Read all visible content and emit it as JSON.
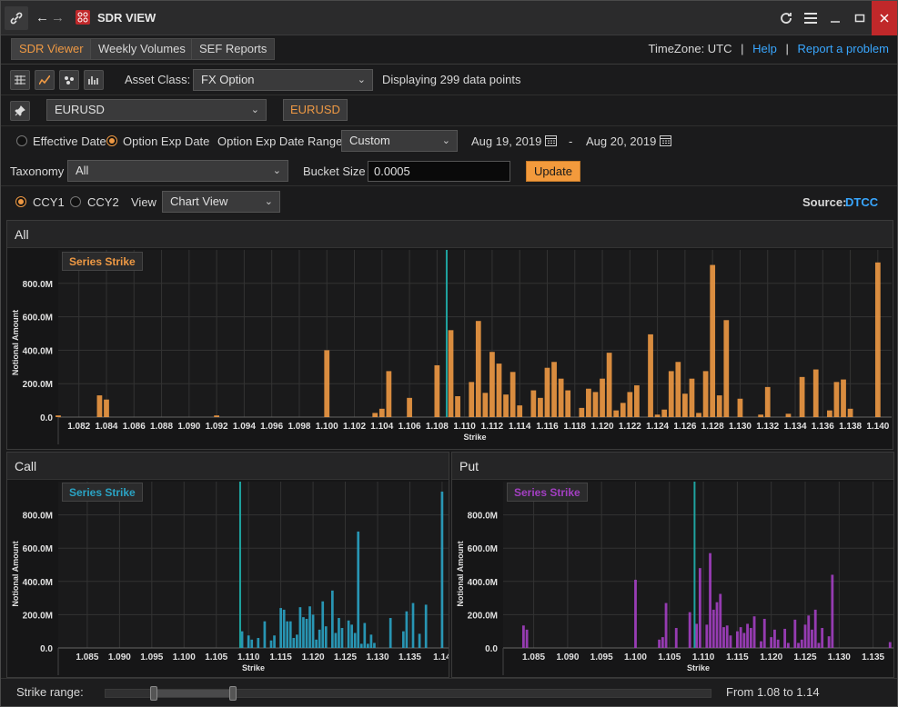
{
  "app": {
    "title": "SDR VIEW"
  },
  "tabs": [
    "SDR Viewer",
    "Weekly Volumes",
    "SEF Reports"
  ],
  "topbar": {
    "timezone": "TimeZone: UTC",
    "sep1": "|",
    "help": "Help",
    "sep2": "|",
    "report": "Report a problem"
  },
  "toolbar": {
    "asset_class_label": "Asset Class:",
    "asset_class_value": "FX Option",
    "displaying": "Displaying 299 data points"
  },
  "pair": {
    "value": "EURUSD",
    "tag": "EURUSD"
  },
  "dates": {
    "effective_label": "Effective Date",
    "option_exp_label": "Option Exp Date",
    "range_label": "Option Exp Date Range",
    "range_value": "Custom",
    "start": "Aug 19, 2019",
    "dash": "-",
    "end": "Aug 20, 2019"
  },
  "filters": {
    "taxonomy_label": "Taxonomy",
    "taxonomy_value": "All",
    "bucket_label": "Bucket Size",
    "bucket_value": "0.0005",
    "update_label": "Update"
  },
  "view": {
    "ccy1": "CCY1",
    "ccy2": "CCY2",
    "view_label": "View",
    "view_value": "Chart View",
    "source_label": "Source:",
    "source_value": "DTCC"
  },
  "panels": {
    "all": "All",
    "call": "Call",
    "put": "Put"
  },
  "footer": {
    "strike_range_label": "Strike range:",
    "range_text": "From 1.08 to 1.14",
    "range_start": 0.08,
    "range_end": 0.21
  },
  "colors": {
    "orange": "#ee9944",
    "call": "#2aa3c4",
    "put": "#a33fc2",
    "marker": "#1fa3a0"
  },
  "chart_data": [
    {
      "type": "bar",
      "series_label": "Series Strike",
      "ylabel": "Notional Amount",
      "xlabel": "Strike",
      "ylim": [
        0,
        1000
      ],
      "xlim": [
        1.0805,
        1.141
      ],
      "xticks": [
        "1.082",
        "1.084",
        "1.086",
        "1.088",
        "1.090",
        "1.092",
        "1.094",
        "1.096",
        "1.098",
        "1.100",
        "1.102",
        "1.104",
        "1.106",
        "1.108",
        "1.110",
        "1.112",
        "1.114",
        "1.116",
        "1.118",
        "1.120",
        "1.122",
        "1.124",
        "1.126",
        "1.128",
        "1.130",
        "1.132",
        "1.134",
        "1.136",
        "1.138",
        "1.140"
      ],
      "xtick_values": [
        1.082,
        1.084,
        1.086,
        1.088,
        1.09,
        1.092,
        1.094,
        1.096,
        1.098,
        1.1,
        1.102,
        1.104,
        1.106,
        1.108,
        1.11,
        1.112,
        1.114,
        1.116,
        1.118,
        1.12,
        1.122,
        1.124,
        1.126,
        1.128,
        1.13,
        1.132,
        1.134,
        1.136,
        1.138,
        1.14
      ],
      "yticks": [
        "0.0",
        "200.0M",
        "400.0M",
        "600.0M",
        "800.0M"
      ],
      "ytick_values": [
        0,
        200,
        400,
        600,
        800
      ],
      "marker_x": 1.1087,
      "x": [
        1.0805,
        1.0835,
        1.084,
        1.092,
        1.1,
        1.1035,
        1.104,
        1.1045,
        1.106,
        1.108,
        1.109,
        1.1095,
        1.1105,
        1.111,
        1.1115,
        1.112,
        1.1125,
        1.113,
        1.1135,
        1.114,
        1.115,
        1.1155,
        1.116,
        1.1165,
        1.117,
        1.1175,
        1.1185,
        1.119,
        1.1195,
        1.12,
        1.1205,
        1.121,
        1.1215,
        1.122,
        1.1225,
        1.1235,
        1.124,
        1.1245,
        1.125,
        1.1255,
        1.126,
        1.1265,
        1.127,
        1.1275,
        1.128,
        1.1285,
        1.129,
        1.13,
        1.1315,
        1.132,
        1.1335,
        1.1345,
        1.1355,
        1.1365,
        1.137,
        1.1375,
        1.138,
        1.14
      ],
      "values": [
        10,
        130,
        105,
        10,
        400,
        25,
        50,
        275,
        115,
        310,
        520,
        125,
        210,
        575,
        145,
        390,
        320,
        135,
        270,
        70,
        160,
        115,
        295,
        330,
        230,
        160,
        55,
        170,
        150,
        230,
        385,
        40,
        85,
        150,
        190,
        495,
        15,
        45,
        275,
        330,
        140,
        230,
        25,
        275,
        910,
        130,
        580,
        110,
        15,
        180,
        20,
        240,
        285,
        40,
        210,
        225,
        50,
        925
      ],
      "color": "#ee9944"
    },
    {
      "type": "bar",
      "series_label": "Series Strike",
      "ylabel": "Notional Amount",
      "xlabel": "Strike",
      "ylim": [
        0,
        1000
      ],
      "xlim": [
        1.0805,
        1.141
      ],
      "xticks": [
        "1.085",
        "1.090",
        "1.095",
        "1.100",
        "1.105",
        "1.110",
        "1.115",
        "1.120",
        "1.125",
        "1.130",
        "1.135",
        "1.14"
      ],
      "xtick_values": [
        1.085,
        1.09,
        1.095,
        1.1,
        1.105,
        1.11,
        1.115,
        1.12,
        1.125,
        1.13,
        1.135,
        1.14
      ],
      "yticks": [
        "0.0",
        "200.0M",
        "400.0M",
        "600.0M",
        "800.0M"
      ],
      "ytick_values": [
        0,
        200,
        400,
        600,
        800
      ],
      "marker_x": 1.1087,
      "x": [
        1.109,
        1.11,
        1.1105,
        1.1115,
        1.1125,
        1.1135,
        1.114,
        1.115,
        1.1155,
        1.116,
        1.1165,
        1.117,
        1.1175,
        1.118,
        1.1185,
        1.119,
        1.1195,
        1.12,
        1.1205,
        1.121,
        1.1215,
        1.122,
        1.123,
        1.1235,
        1.124,
        1.1245,
        1.1255,
        1.126,
        1.1265,
        1.127,
        1.1275,
        1.128,
        1.1285,
        1.129,
        1.1295,
        1.132,
        1.134,
        1.1345,
        1.1355,
        1.1365,
        1.1375,
        1.14
      ],
      "values": [
        100,
        75,
        50,
        60,
        160,
        45,
        75,
        240,
        230,
        160,
        160,
        60,
        80,
        245,
        185,
        175,
        250,
        200,
        50,
        110,
        280,
        130,
        345,
        90,
        180,
        120,
        165,
        140,
        90,
        700,
        25,
        150,
        25,
        80,
        30,
        180,
        100,
        220,
        270,
        85,
        260,
        940
      ],
      "color": "#2aa3c4"
    },
    {
      "type": "bar",
      "series_label": "Series Strike",
      "ylabel": "Notional Amount",
      "xlabel": "Strike",
      "ylim": [
        0,
        1000
      ],
      "xlim": [
        1.0805,
        1.138
      ],
      "xticks": [
        "1.085",
        "1.090",
        "1.095",
        "1.100",
        "1.105",
        "1.110",
        "1.115",
        "1.120",
        "1.125",
        "1.130",
        "1.135"
      ],
      "xtick_values": [
        1.085,
        1.09,
        1.095,
        1.1,
        1.105,
        1.11,
        1.115,
        1.12,
        1.125,
        1.13,
        1.135
      ],
      "yticks": [
        "0.0",
        "200.0M",
        "400.0M",
        "600.0M",
        "800.0M"
      ],
      "ytick_values": [
        0,
        200,
        400,
        600,
        800
      ],
      "marker_x": 1.1087,
      "x": [
        1.0835,
        1.084,
        1.1,
        1.1035,
        1.104,
        1.1045,
        1.106,
        1.108,
        1.109,
        1.1095,
        1.1105,
        1.111,
        1.1115,
        1.112,
        1.1125,
        1.113,
        1.1135,
        1.114,
        1.115,
        1.1155,
        1.116,
        1.1165,
        1.117,
        1.1175,
        1.1185,
        1.119,
        1.12,
        1.1205,
        1.121,
        1.122,
        1.1225,
        1.1235,
        1.124,
        1.1245,
        1.125,
        1.1255,
        1.126,
        1.1265,
        1.127,
        1.1275,
        1.1285,
        1.129,
        1.1375
      ],
      "values": [
        135,
        110,
        410,
        50,
        65,
        270,
        120,
        215,
        145,
        480,
        140,
        570,
        230,
        275,
        325,
        125,
        135,
        75,
        100,
        125,
        90,
        145,
        120,
        190,
        40,
        175,
        65,
        110,
        50,
        115,
        30,
        170,
        30,
        50,
        140,
        195,
        110,
        230,
        30,
        120,
        70,
        440,
        35
      ],
      "color": "#a33fc2"
    }
  ]
}
